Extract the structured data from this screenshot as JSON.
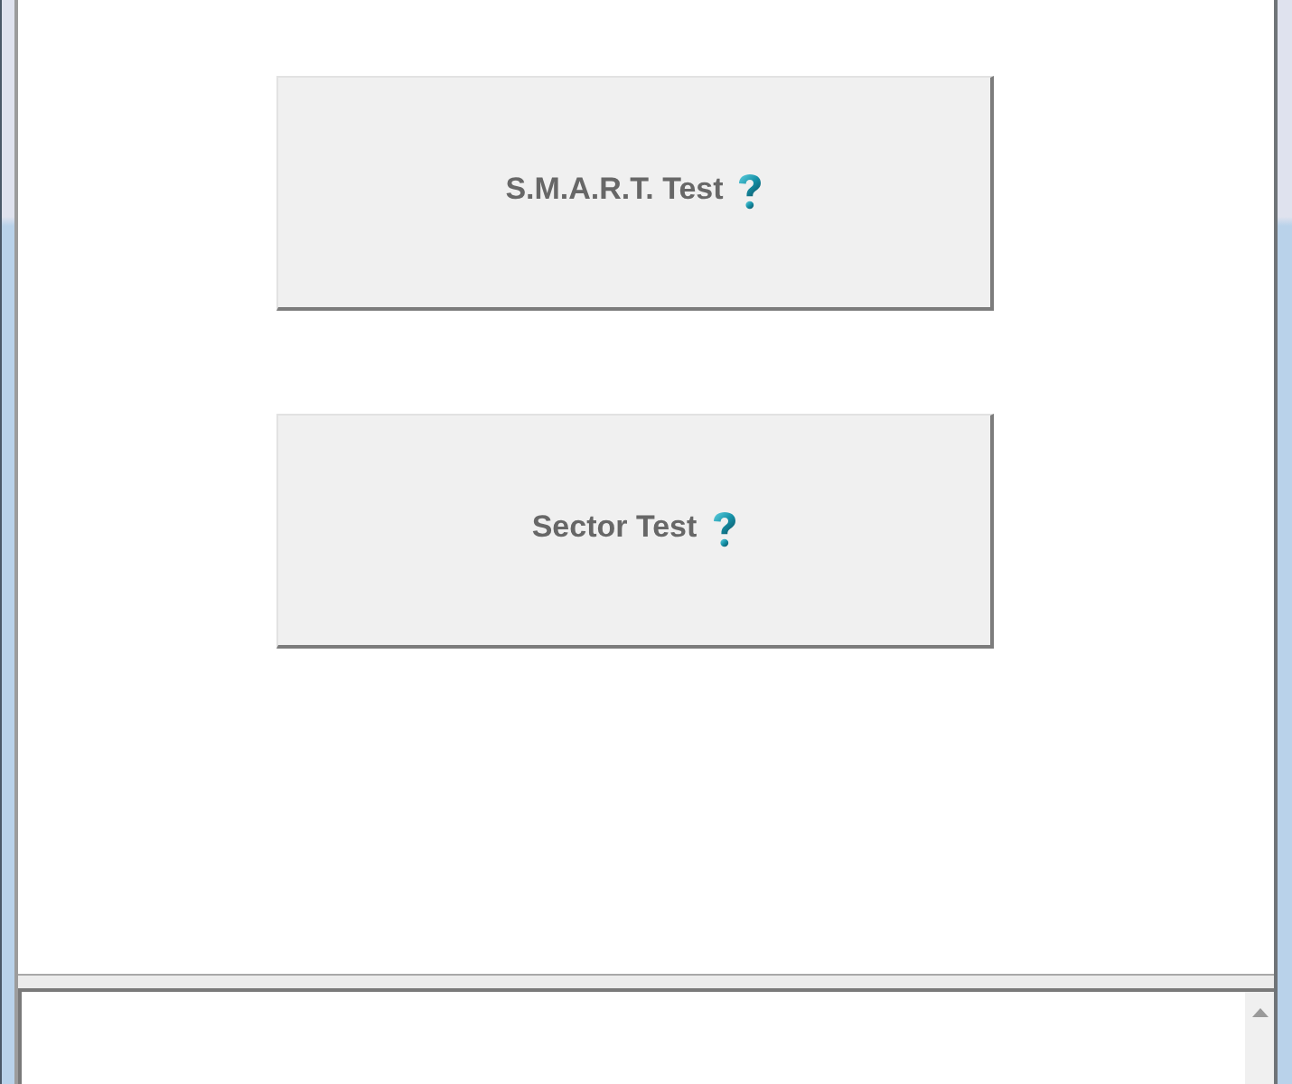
{
  "buttons": [
    {
      "label": "S.M.A.R.T. Test",
      "help_icon": true
    },
    {
      "label": "Sector Test",
      "help_icon": true
    }
  ]
}
